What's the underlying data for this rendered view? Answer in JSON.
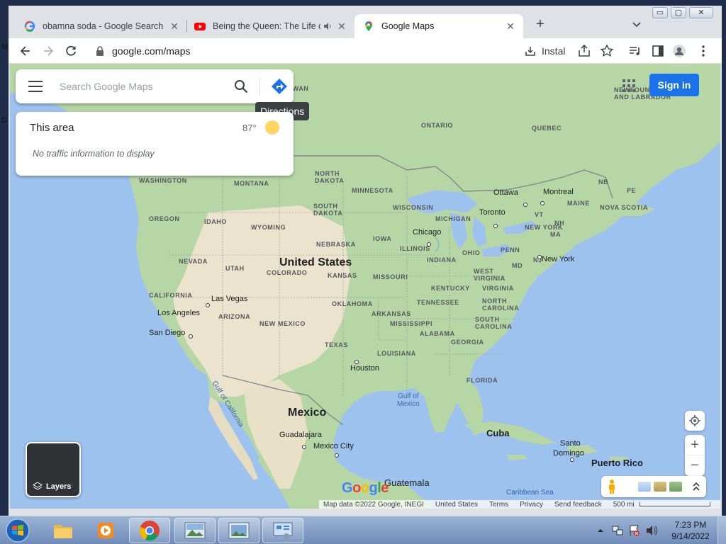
{
  "browser": {
    "tabs": [
      {
        "label": "obamna soda - Google Search",
        "icon": "google-g-icon",
        "active": false
      },
      {
        "label": "Being the Queen: The Life of",
        "icon": "youtube-icon",
        "active": false,
        "audio": true
      },
      {
        "label": "Google Maps",
        "icon": "google-maps-pin-icon",
        "active": true
      }
    ],
    "new_tab_label": "+",
    "url": "google.com/maps",
    "install_label": "Instal",
    "window_controls": {
      "minimize": "▭",
      "maximize": "▢",
      "close": "✕"
    }
  },
  "maps": {
    "search_placeholder": "Search Google Maps",
    "directions_tooltip": "Directions",
    "area_card": {
      "title": "This area",
      "temperature": "87°",
      "traffic_note": "No traffic information to display"
    },
    "signin_label": "Sign in",
    "layers_label": "Layers",
    "zoom_in": "+",
    "zoom_out": "−",
    "google_logo": "Google",
    "attribution": [
      "Map data ©2022 Google, INEGI",
      "United States",
      "Terms",
      "Privacy",
      "Send feedback",
      "500 mi"
    ],
    "place_labels": {
      "ontario": "ONTARIO",
      "quebec": "QUEBEC",
      "newfoundland": "NEWFOUN​DLAND",
      "newfoundland_l1": "NEWFOUN",
      "newfoundland_l2": "AND LABRADOR",
      "saskatchewan_fragment": "EWAN",
      "north_dakota_l1": "NORTH",
      "north_dakota_l2": "DAKOTA",
      "south_dakota_l1": "SOUTH",
      "south_dakota_l2": "DAKOTA",
      "minnesota": "MINNESOTA",
      "wisconsin": "WISCONSIN",
      "michigan": "MICHIGAN",
      "montana": "MONTANA",
      "washington": "WASHINGTON",
      "oregon": "OREGON",
      "idaho": "IDAHO",
      "wyoming": "WYOMING",
      "nebraska": "NEBRASKA",
      "iowa": "IOWA",
      "illinois": "ILLINOIS",
      "indiana": "INDIANA",
      "ohio": "OHIO",
      "penn": "PENN",
      "new_york_state": "NEW YORK",
      "vt": "VT",
      "nh": "NH",
      "ma": "MA",
      "maine": "MAINE",
      "nb": "NB",
      "pe": "PE",
      "nova_scotia": "NOVA SCOTIA",
      "nevada": "NEVADA",
      "utah": "UTAH",
      "colorado": "COLORADO",
      "kansas": "KANSAS",
      "missouri": "MISSOURI",
      "kentucky": "KENTUCKY",
      "west_virginia_l1": "WEST",
      "west_virginia_l2": "VIRGINIA",
      "virginia": "VIRGINIA",
      "md": "MD",
      "nj": "NJ",
      "california": "CALIFORNIA",
      "arizona": "ARIZONA",
      "new_mexico": "NEW MEXICO",
      "oklahoma": "OKLAHOMA",
      "arkansas": "ARKANSAS",
      "tennessee": "TENNESSEE",
      "north_carolina_l1": "NORTH",
      "north_carolina_l2": "CAROLINA",
      "south_carolina_l1": "SOUTH",
      "south_carolina_l2": "CAROLINA",
      "mississippi": "MISSISSIPPI",
      "alabama": "ALABAMA",
      "georgia": "GEORGIA",
      "texas": "TEXAS",
      "louisiana": "LOUISIANA",
      "florida": "FLORIDA"
    },
    "cities": {
      "ottawa": "Ottawa",
      "montreal": "Montreal",
      "toronto": "Toronto",
      "chicago": "Chicago",
      "new_york": "New York",
      "las_vegas": "Las Vegas",
      "los_angeles": "Los Angeles",
      "san_diego": "San Diego",
      "houston": "Houston",
      "guadalajara": "Guadalajara",
      "mexico_city": "Mexico City",
      "santo_domingo_l1": "Santo",
      "santo_domingo_l2": "Domingo",
      "guatemala": "Guatemala"
    },
    "countries": {
      "united_states": "United States",
      "mexico": "Mexico",
      "cuba": "Cuba",
      "puerto_rico": "Puerto Rico"
    },
    "water": {
      "gulf_of_mexico_l1": "Gulf of",
      "gulf_of_mexico_l2": "Mexico",
      "gulf_of_california": "Gulf of California",
      "caribbean": "Caribbean Sea"
    }
  },
  "taskbar": {
    "time": "7:23 PM",
    "date": "9/14/2022"
  },
  "desktop_side_letters": [
    "M",
    "D"
  ],
  "colors": {
    "accent_blue": "#1a73e8",
    "water": "#9ec2ee",
    "land_green": "#b4d8a7",
    "land_tan": "#eee6d4"
  }
}
